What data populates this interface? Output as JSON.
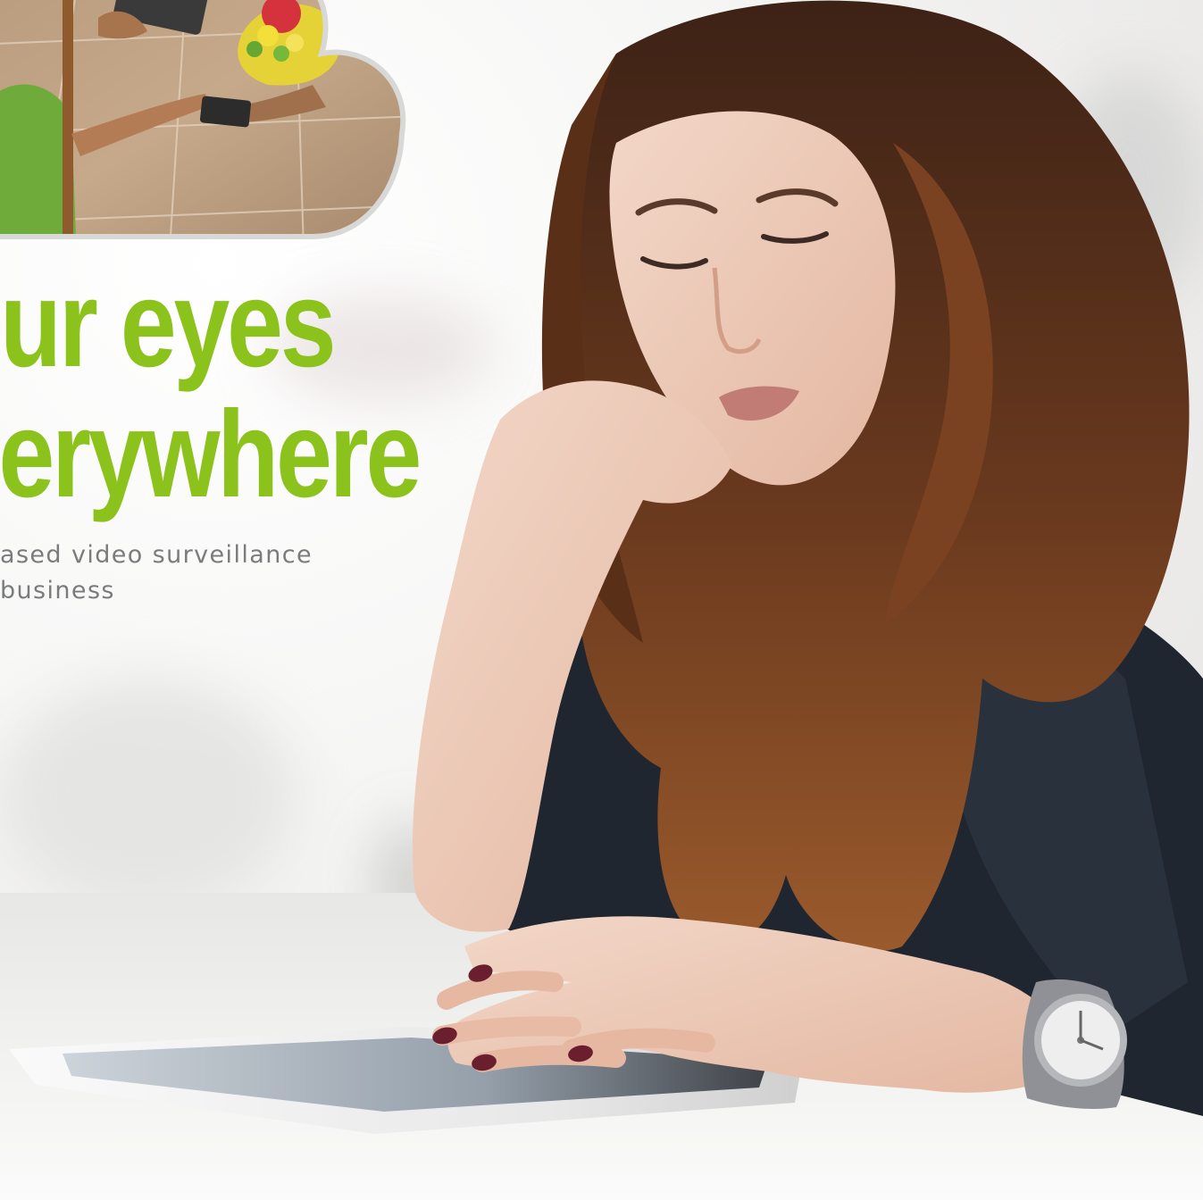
{
  "headline": {
    "line1": "ur eyes",
    "line2": "erywhere"
  },
  "subheadline": {
    "line1": "ased video surveillance",
    "line2": " business"
  },
  "colors": {
    "accent_green": "#8cc21c",
    "body_text_gray": "#7a7b7d"
  }
}
